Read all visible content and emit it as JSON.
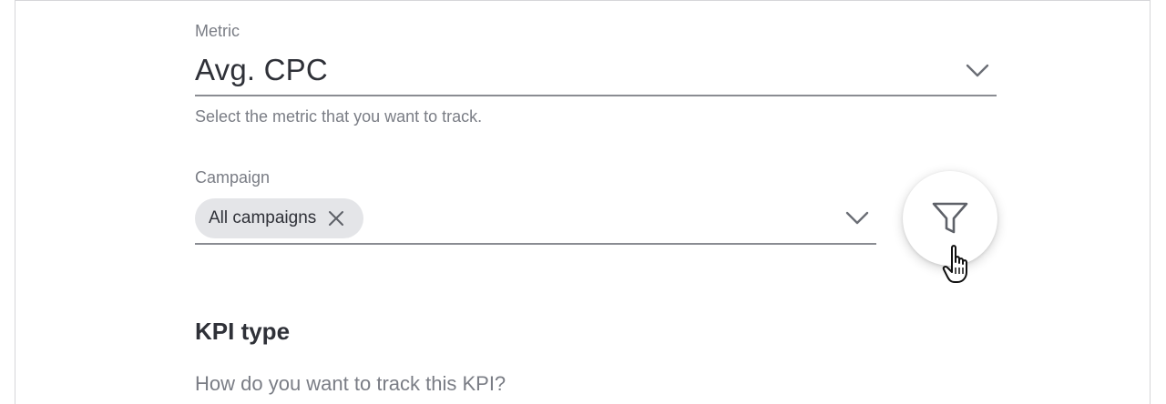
{
  "metric": {
    "label": "Metric",
    "value": "Avg. CPC",
    "helper": "Select the metric that you want to track."
  },
  "campaign": {
    "label": "Campaign",
    "chip": "All campaigns"
  },
  "kpi": {
    "title": "KPI type",
    "question": "How do you want to track this KPI?"
  },
  "icons": {
    "metric_dropdown": "chevron-down-icon",
    "campaign_dropdown": "chevron-down-icon",
    "chip_remove": "close-icon",
    "filter": "filter-icon",
    "pointer": "hand-pointer-icon"
  },
  "colors": {
    "text_primary": "#2f3138",
    "text_secondary": "#7a7d85",
    "chip_bg": "#e4e5e8",
    "underline": "#8a8c92"
  }
}
